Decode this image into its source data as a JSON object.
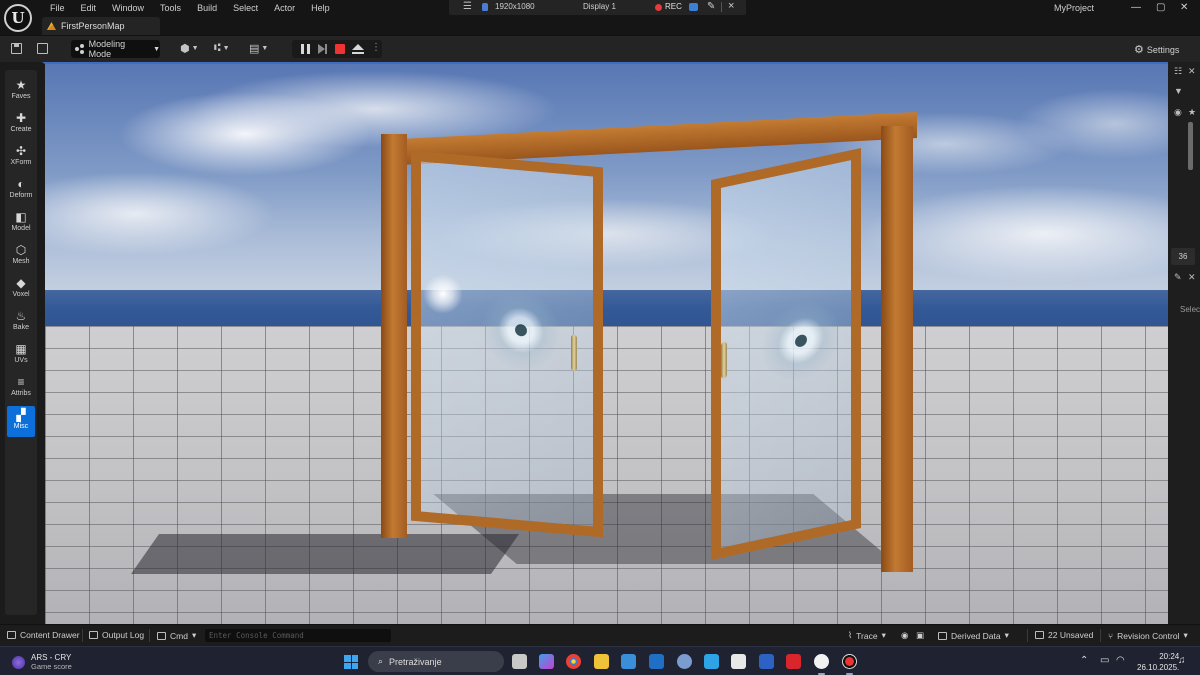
{
  "menubar": {
    "logo": "U",
    "menus": [
      "File",
      "Edit",
      "Window",
      "Tools",
      "Build",
      "Select",
      "Actor",
      "Help"
    ],
    "project": "MyProject",
    "window_controls": [
      "—",
      "▢",
      "✕"
    ]
  },
  "recorder": {
    "resolution": "1920x1080",
    "display": "Display 1",
    "rec_label": "REC"
  },
  "tab": {
    "map_name": "FirstPersonMap"
  },
  "toolbar": {
    "mode_label": "Modeling Mode",
    "settings_label": "Settings"
  },
  "modes_panel": {
    "items": [
      {
        "label": "Faves",
        "glyph": "★"
      },
      {
        "label": "Create",
        "glyph": "✚"
      },
      {
        "label": "XForm",
        "glyph": "✣"
      },
      {
        "label": "Deform",
        "glyph": "◐"
      },
      {
        "label": "Model",
        "glyph": "◧"
      },
      {
        "label": "Mesh",
        "glyph": "⬡"
      },
      {
        "label": "Voxel",
        "glyph": "◆"
      },
      {
        "label": "Bake",
        "glyph": "♨"
      },
      {
        "label": "UVs",
        "glyph": "▦"
      },
      {
        "label": "Attribs",
        "glyph": "≡"
      },
      {
        "label": "Misc",
        "glyph": "▞"
      }
    ],
    "active": "Misc"
  },
  "right_strip": {
    "number": "36",
    "label": "Selec"
  },
  "statusbar": {
    "content_drawer": "Content Drawer",
    "output_log": "Output Log",
    "cmd": "Cmd",
    "console_placeholder": "Enter Console Command",
    "trace": "Trace",
    "derived_data": "Derived Data",
    "unsaved": "22 Unsaved",
    "revision_control": "Revision Control"
  },
  "taskbar": {
    "game_title": "ARS - CRY",
    "game_sub": "Game score",
    "search_label": "Pretraživanje",
    "time": "20:24",
    "date": "26.10.2025."
  },
  "colors": {
    "accent": "#0d6fd9",
    "rec_red": "#e83a3a",
    "viewport_border": "#3f6cc3"
  }
}
